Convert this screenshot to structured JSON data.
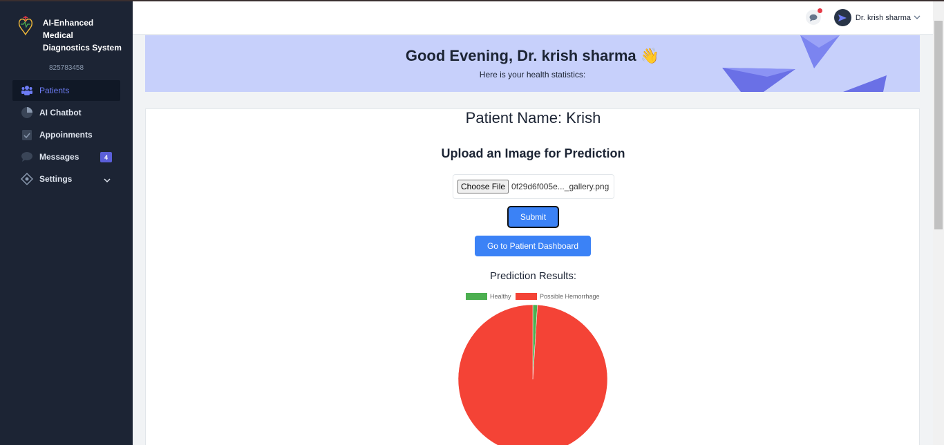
{
  "sidebar": {
    "brand": "AI-Enhanced Medical Diagnostics System",
    "brand_line1": "AI-Enhanced Medical",
    "brand_line2": "Diagnostics System",
    "user_id": "825783458",
    "items": [
      {
        "label": "Patients",
        "icon": "users-icon",
        "active": true
      },
      {
        "label": "AI Chatbot",
        "icon": "chart-icon"
      },
      {
        "label": "Appoinments",
        "icon": "calendar-check-icon"
      },
      {
        "label": "Messages",
        "icon": "message-icon",
        "badge": "4"
      },
      {
        "label": "Settings",
        "icon": "settings-icon",
        "has_dropdown": true
      }
    ]
  },
  "header": {
    "user_name": "Dr. krish sharma"
  },
  "banner": {
    "title": "Good Evening, Dr. krish sharma 👋",
    "subtitle": "Here is your health statistics:"
  },
  "main": {
    "patient_name": "Patient Name: Krish",
    "upload_title": "Upload an Image for Prediction",
    "choose_file_label": "Choose File",
    "file_name": "0f29d6f005e..._gallery.png",
    "submit_label": "Submit",
    "dashboard_label": "Go to Patient Dashboard",
    "results_title": "Prediction Results:"
  },
  "colors": {
    "sidebar_bg": "#1c2434",
    "accent": "#3b82f6",
    "healthy": "#4caf50",
    "hemorrhage": "#f44336",
    "banner_bg": "#c7d0fb"
  },
  "chart_data": {
    "type": "pie",
    "categories": [
      "Healthy",
      "Possible Hemorrhage"
    ],
    "values": [
      1,
      99
    ],
    "colors": [
      "#4caf50",
      "#f44336"
    ],
    "legend": "top"
  }
}
